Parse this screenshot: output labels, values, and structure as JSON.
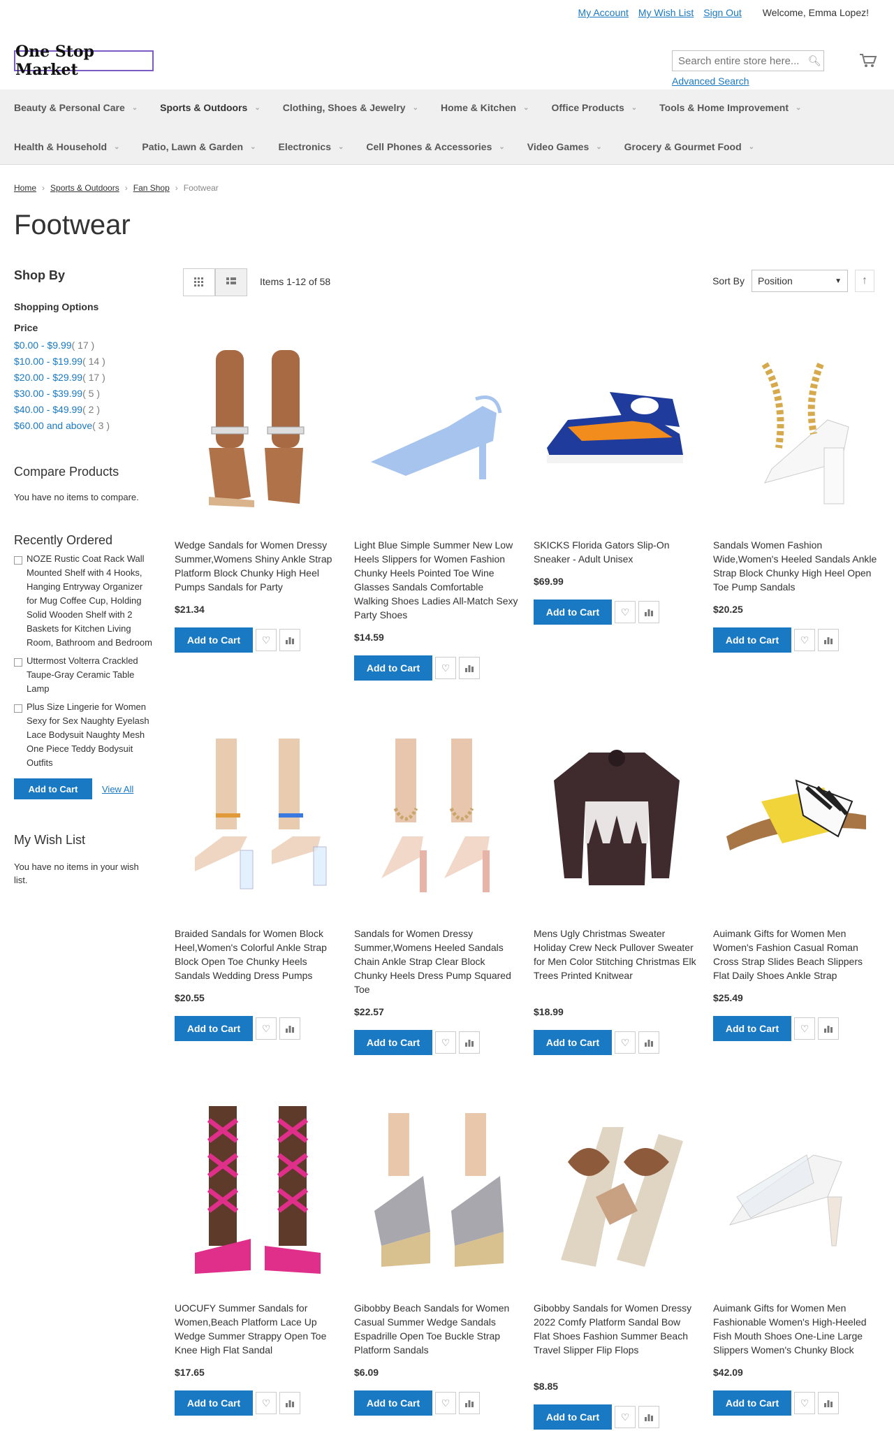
{
  "header": {
    "my_account": "My Account",
    "my_wish_list": "My Wish List",
    "sign_out": "Sign Out",
    "welcome": "Welcome, Emma Lopez!",
    "logo_text": "One Stop Market",
    "search_placeholder": "Search entire store here...",
    "advanced_search": "Advanced Search"
  },
  "nav": {
    "row1": [
      "Beauty & Personal Care",
      "Sports & Outdoors",
      "Clothing, Shoes & Jewelry",
      "Home & Kitchen",
      "Office Products",
      "Tools & Home Improvement"
    ],
    "row2": [
      "Health & Household",
      "Patio, Lawn & Garden",
      "Electronics",
      "Cell Phones & Accessories",
      "Video Games",
      "Grocery & Gourmet Food"
    ]
  },
  "breadcrumb": [
    "Home",
    "Sports & Outdoors",
    "Fan Shop",
    "Footwear"
  ],
  "page_title": "Footwear",
  "sidebar": {
    "shop_by": "Shop By",
    "shopping_options": "Shopping Options",
    "price_label": "Price",
    "price_ranges": [
      {
        "label": "$0.00 - $9.99",
        "count": "( 17 )"
      },
      {
        "label": "$10.00 - $19.99",
        "count": "( 14 )"
      },
      {
        "label": "$20.00 - $29.99",
        "count": "( 17 )"
      },
      {
        "label": "$30.00 - $39.99",
        "count": "( 5 )"
      },
      {
        "label": "$40.00 - $49.99",
        "count": "( 2 )"
      },
      {
        "label": "$60.00 and above",
        "count": "( 3 )"
      }
    ],
    "compare_title": "Compare Products",
    "compare_text": "You have no items to compare.",
    "recent_title": "Recently Ordered",
    "recent_items": [
      "NOZE Rustic Coat Rack Wall Mounted Shelf with 4 Hooks, Hanging Entryway Organizer for Mug Coffee Cup, Holding Solid Wooden Shelf with 2 Baskets for Kitchen Living Room, Bathroom and Bedroom",
      "Uttermost Volterra Crackled Taupe-Gray Ceramic Table Lamp",
      "Plus Size Lingerie for Women Sexy for Sex Naughty Eyelash Lace Bodysuit Naughty Mesh One Piece Teddy Bodysuit Outfits"
    ],
    "add_to_cart": "Add to Cart",
    "view_all": "View All",
    "wishlist_title": "My Wish List",
    "wishlist_text": "You have no items in your wish list."
  },
  "toolbar": {
    "amount": "Items 1-12 of 58",
    "sort_by": "Sort By",
    "sort_value": "Position"
  },
  "products": [
    {
      "name": "Wedge Sandals for Women Dressy Summer,Womens Shiny Ankle Strap Platform Block Chunky High Heel Pumps Sandals for Party",
      "price": "$21.34",
      "image": "jeweled-ankle-strap-sandal"
    },
    {
      "name": "Light Blue Simple Summer New Low Heels Slippers for Women Fashion Chunky Heels Pointed Toe Wine Glasses Sandals Comfortable Walking Shoes Ladies All-Match Sexy Party Shoes",
      "price": "$14.59",
      "image": "light-blue-slingback-heel"
    },
    {
      "name": "SKICKS Florida Gators Slip-On Sneaker - Adult Unisex",
      "price": "$69.99",
      "image": "blue-orange-slip-on-sneaker"
    },
    {
      "name": "Sandals Women Fashion Wide,Women's Heeled Sandals Ankle Strap Block Chunky High Heel Open Toe Pump Sandals",
      "price": "$20.25",
      "image": "white-chain-block-heel"
    },
    {
      "name": "Braided Sandals for Women Block Heel,Women's Colorful Ankle Strap Block Open Toe Chunky Heels Sandals Wedding Dress Pumps",
      "price": "$20.55",
      "image": "clear-block-heel-sandal"
    },
    {
      "name": "Sandals for Women Dressy Summer,Womens Heeled Sandals Chain Ankle Strap Clear Block Chunky Heels Dress Pump Squared Toe",
      "price": "$22.57",
      "image": "clear-chain-heel-sandal"
    },
    {
      "name": "Mens Ugly Christmas Sweater Holiday Crew Neck Pullover Sweater for Men Color Stitching Christmas Elk Trees Printed Knitwear",
      "price": "$18.99",
      "image": "christmas-elk-sweater"
    },
    {
      "name": "Auimank Gifts for Women Men Women's Fashion Casual Roman Cross Strap Slides Beach Slippers Flat Daily Shoes Ankle Strap",
      "price": "$25.49",
      "image": "zebra-yellow-cross-slide"
    },
    {
      "name": "UOCUFY Summer Sandals for Women,Beach Platform Lace Up Wedge Summer Strappy Open Toe Knee High Flat Sandal",
      "price": "$17.65",
      "image": "pink-lace-up-sandal"
    },
    {
      "name": "Gibobby Beach Sandals for Women Casual Summer Wedge Sandals Espadrille Open Toe Buckle Strap Platform Sandals",
      "price": "$6.09",
      "image": "grey-espadrille-wedge"
    },
    {
      "name": "Gibobby Sandals for Women Dressy 2022 Comfy Platform Sandal Bow Flat Shoes Fashion Summer Beach Travel Slipper Flip Flops",
      "price": "$8.85",
      "image": "brown-bow-platform-slide"
    },
    {
      "name": "Auimank Gifts for Women Men Fashionable Women's High-Heeled Fish Mouth Shoes One-Line Large Slippers Women's Chunky Block",
      "price": "$42.09",
      "image": "clear-mule-heel"
    }
  ],
  "buttons": {
    "add_to_cart": "Add to Cart"
  },
  "colors": {
    "accent": "#1979c3",
    "nav_bg": "#f0f0f0",
    "text": "#333333"
  }
}
